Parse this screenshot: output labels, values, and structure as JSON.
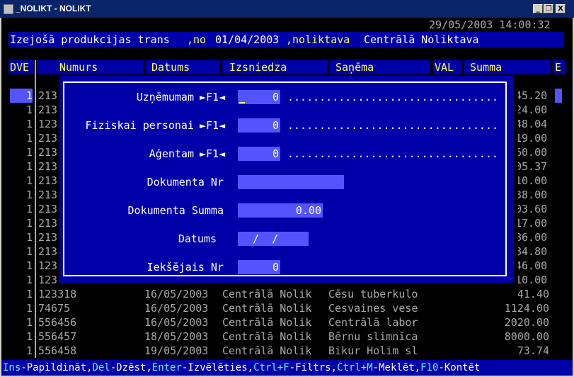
{
  "window": {
    "title": "_NOLIKT - NOLIKT",
    "min_label": "_",
    "restore_label": "❐",
    "close_label": "X"
  },
  "console": {
    "datetime": "29/05/2003 14:00:32",
    "header": {
      "p1": "Izejošā produkcijas trans",
      "p2": ",no ",
      "date": "01/04/2003",
      "p3": ",noliktava ",
      "warehouse": "Centrālā Noliktava"
    },
    "columns": {
      "dve": "DVE",
      "numurs": "Numurs",
      "datums": "Datums",
      "izsniedza": "Izsniedza",
      "sanema": "Saņēma",
      "val": "VAL",
      "summa": "Summa",
      "e": "E"
    },
    "rows_partial": [
      {
        "dve": "1",
        "num": "213",
        "sum_end": "45.20"
      },
      {
        "dve": "1",
        "num": "213",
        "sum_end": "24.00"
      },
      {
        "dve": "1",
        "num": "123",
        "sum_end": "48.04"
      },
      {
        "dve": "1",
        "num": "213",
        "sum_end": "19.00"
      },
      {
        "dve": "1",
        "num": "213",
        "sum_end": "60.00"
      },
      {
        "dve": "1",
        "num": "213",
        "sum_end": "05.37"
      },
      {
        "dve": "1",
        "num": "213",
        "sum_end": "10.00"
      },
      {
        "dve": "1",
        "num": "213",
        "sum_end": "38.00"
      },
      {
        "dve": "1",
        "num": "213",
        "sum_end": "03.60"
      },
      {
        "dve": "1",
        "num": "213",
        "sum_end": "17.00"
      },
      {
        "dve": "1",
        "num": "213",
        "sum_end": "86.00"
      },
      {
        "dve": "1",
        "num": "213",
        "sum_end": "84.80"
      },
      {
        "dve": "1",
        "num": "123",
        "sum_end": "46.00"
      },
      {
        "dve": "1",
        "num": "123",
        "sum_end": "10.00"
      }
    ],
    "rows_full": [
      {
        "dve": "1",
        "num": "123318",
        "date": "16/05/2003",
        "izsn": "Centrālā Nolik",
        "san": "Cēsu tuberkulo",
        "sum": "41.40"
      },
      {
        "dve": "1",
        "num": "74675",
        "date": "16/05/2003",
        "izsn": "Centrālā Nolik",
        "san": "Cesvaines vese",
        "sum": "1124.00"
      },
      {
        "dve": "1",
        "num": "556456",
        "date": "16/05/2003",
        "izsn": "Centrālā Nolik",
        "san": "Centrālā labor",
        "sum": "2020.00"
      },
      {
        "dve": "1",
        "num": "556457",
        "date": "18/05/2003",
        "izsn": "Centrālā Nolik",
        "san": "Bērnu slimnīca",
        "sum": "8000.00"
      },
      {
        "dve": "1",
        "num": "556458",
        "date": "19/05/2003",
        "izsn": "Centrālā Nolik",
        "san": "Bikur Holim sl",
        "sum": "73.74"
      }
    ],
    "dialog": {
      "f1_tag": "►F1◄",
      "dots": ".................................",
      "uznemumam": {
        "label": "Uzņēmumam",
        "value": "0"
      },
      "fiziskai": {
        "label": "Fiziskai personai",
        "value": "0"
      },
      "agentam": {
        "label": "Aģentam",
        "value": "0"
      },
      "dok_nr": {
        "label": "Dokumenta Nr",
        "value": ""
      },
      "dok_summa": {
        "label": "Dokumenta Summa",
        "value": "0.00"
      },
      "datums": {
        "label": "Datums",
        "value": " /  /"
      },
      "iekseja": {
        "label": "Iekšējais Nr",
        "value": "0"
      }
    },
    "status": {
      "ins_key": "Ins",
      "ins_label": "-Papildināt,",
      "del_key": "Del",
      "del_label": "-Dzēst,",
      "enter_key": "Enter",
      "enter_label": "-Izvēlēties,",
      "ctrlf_key": "Ctrl+F",
      "ctrlf_label": "-Filtrs,",
      "ctrlm_key": "Ctrl+M",
      "ctrlm_label": "-Meklēt,",
      "f10_key": "F10",
      "f10_label": "-Kontēt"
    }
  }
}
